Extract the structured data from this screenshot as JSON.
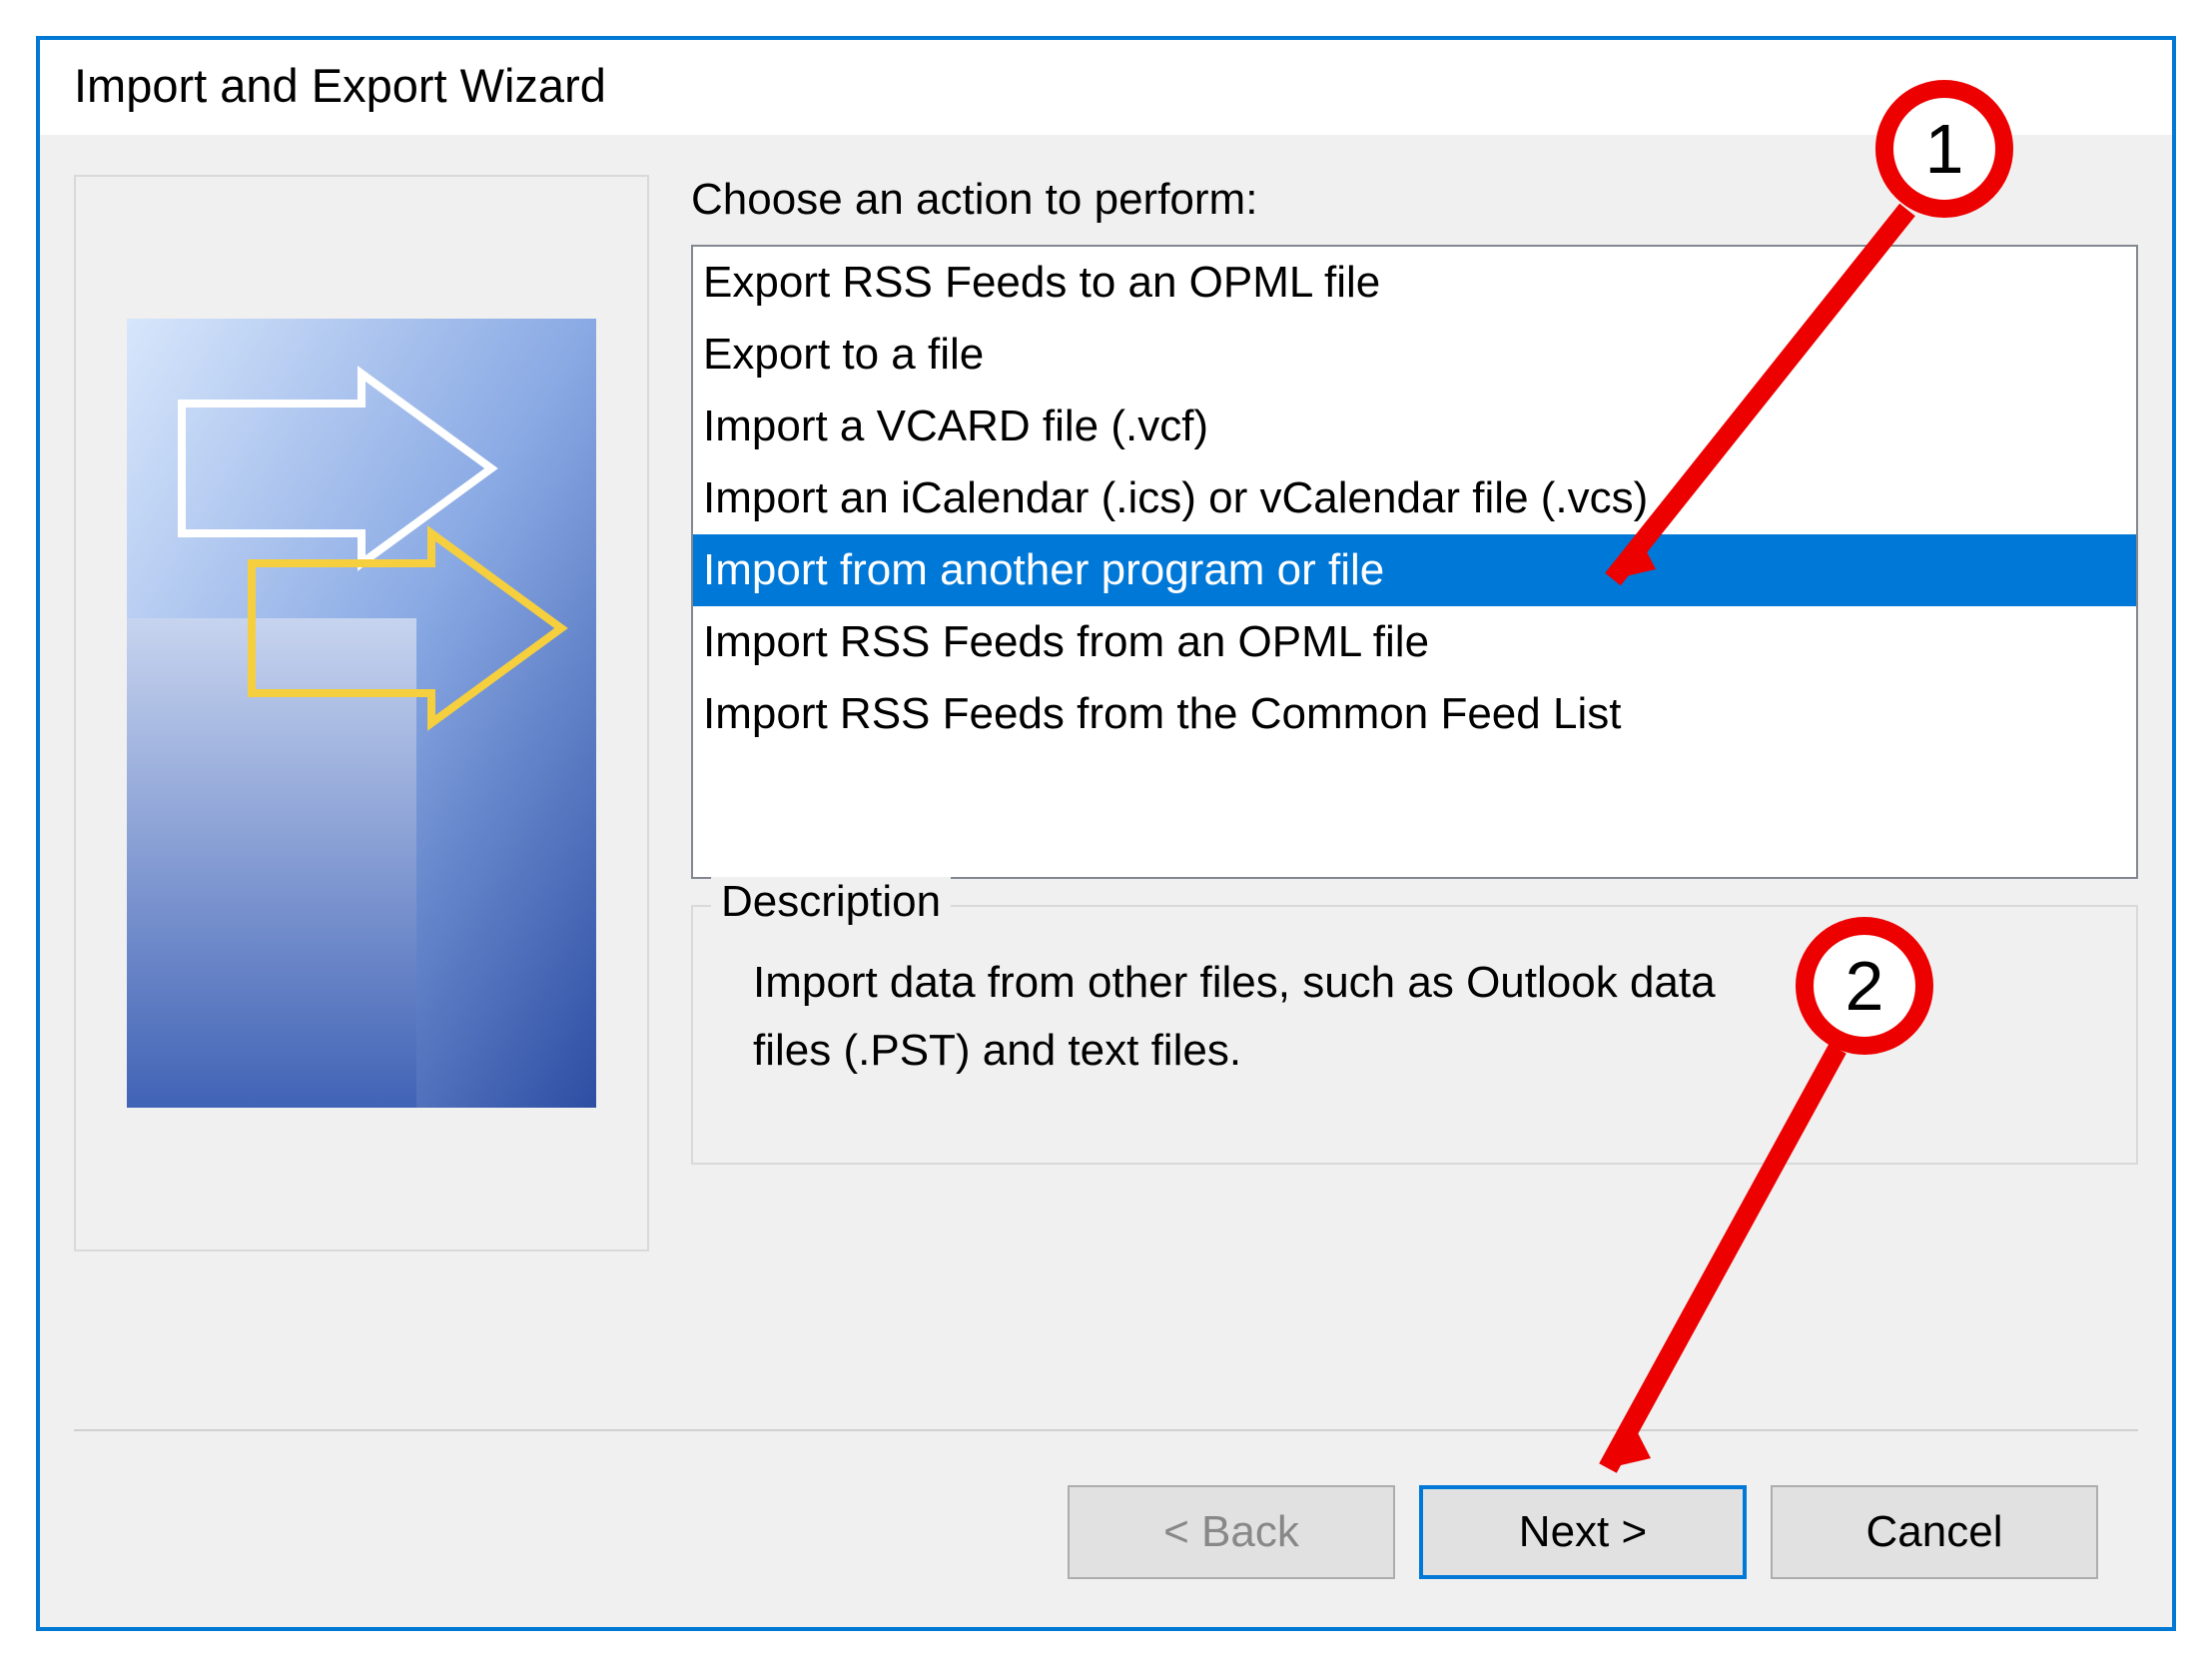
{
  "window": {
    "title": "Import and Export Wizard"
  },
  "main": {
    "prompt": "Choose an action to perform:",
    "actions": [
      "Export RSS Feeds to an OPML file",
      "Export to a file",
      "Import a VCARD file (.vcf)",
      "Import an iCalendar (.ics) or vCalendar file (.vcs)",
      "Import from another program or file",
      "Import RSS Feeds from an OPML file",
      "Import RSS Feeds from the Common Feed List"
    ],
    "selected_index": 4,
    "description_label": "Description",
    "description_text": "Import data from other files, such as Outlook data files (.PST) and text files."
  },
  "buttons": {
    "back": "< Back",
    "next": "Next >",
    "cancel": "Cancel"
  },
  "annotations": {
    "badge1": "1",
    "badge2": "2"
  },
  "colors": {
    "accent": "#0078d7",
    "annotation": "#ed0000",
    "border": "#d9d9d9"
  }
}
